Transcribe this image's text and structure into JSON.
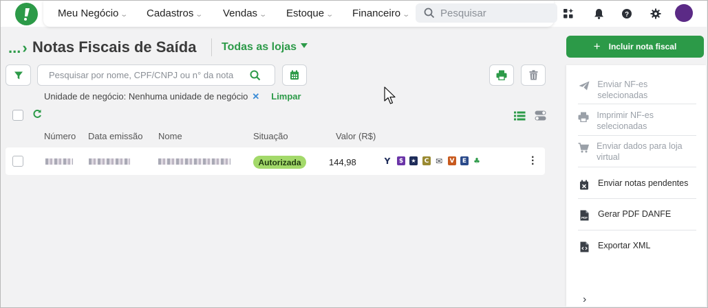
{
  "topbar": {
    "nav": [
      {
        "label": "Meu Negócio"
      },
      {
        "label": "Cadastros"
      },
      {
        "label": "Vendas"
      },
      {
        "label": "Estoque"
      },
      {
        "label": "Financeiro"
      }
    ],
    "search_placeholder": "Pesquisar"
  },
  "page": {
    "breadcrumb": "...",
    "title": "Notas Fiscais de Saída",
    "store_selector": "Todas as lojas"
  },
  "list": {
    "search_placeholder": "Pesquisar por nome, CPF/CNPJ ou n° da nota",
    "filter_text": "Unidade de negócio: Nenhuma unidade de negócio",
    "clear_label": "Limpar",
    "columns": [
      "Número",
      "Data emissão",
      "Nome",
      "Situação",
      "Valor (R$)"
    ],
    "rows": [
      {
        "status": "Autorizada",
        "value": "144,98",
        "status_color": "#a3d96a"
      }
    ],
    "status_icons": [
      {
        "name": "y-cart-icon",
        "glyph": "Y",
        "color": "#1f2d5a"
      },
      {
        "name": "dollar-icon",
        "glyph": "$",
        "color": "#6b35a8"
      },
      {
        "name": "star-badge-icon",
        "glyph": "★",
        "color": "#1f2d5a"
      },
      {
        "name": "c-icon",
        "glyph": "C",
        "color": "#9a8a32"
      },
      {
        "name": "envelope-icon",
        "glyph": "✉",
        "color": "#3a3f47"
      },
      {
        "name": "v-icon",
        "glyph": "V",
        "color": "#c85a1e"
      },
      {
        "name": "e-icon",
        "glyph": "E",
        "color": "#2a4a8a"
      },
      {
        "name": "leaf-icon",
        "glyph": "♣",
        "color": "#2c9a48"
      }
    ]
  },
  "sidebar": {
    "primary_label": "Incluir nota fiscal",
    "actions": [
      {
        "label": "Enviar NF-es selecionadas",
        "enabled": false,
        "icon": "send-icon"
      },
      {
        "label": "Imprimir NF-es selecionadas",
        "enabled": false,
        "icon": "print-icon"
      },
      {
        "label": "Enviar dados para loja virtual",
        "enabled": false,
        "icon": "cart-icon"
      },
      {
        "label": "Enviar notas pendentes",
        "enabled": true,
        "icon": "calendar-x-icon"
      },
      {
        "label": "Gerar PDF DANFE",
        "enabled": true,
        "icon": "pdf-icon"
      },
      {
        "label": "Exportar XML",
        "enabled": true,
        "icon": "xml-file-icon"
      }
    ]
  },
  "colors": {
    "brand_green": "#2c9a48",
    "status_authorized": "#a3d96a"
  }
}
